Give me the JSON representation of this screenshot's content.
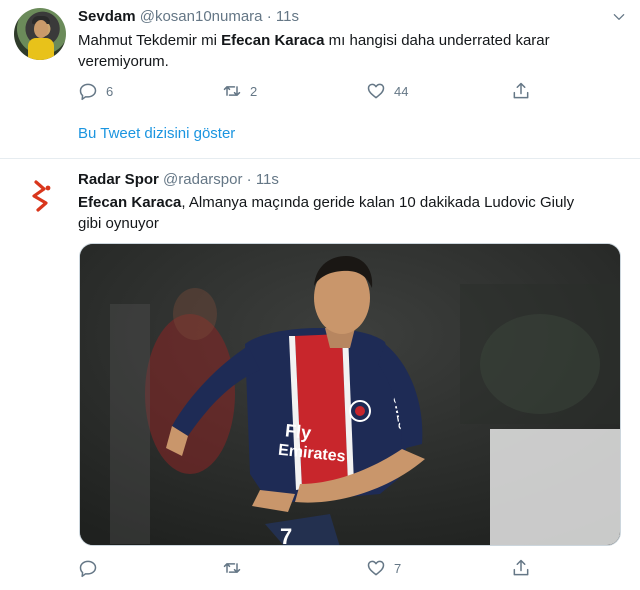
{
  "tweet1": {
    "name": "Sevdam",
    "handle": "@kosan10numara",
    "separator": "·",
    "time": "11s",
    "text_part1": "Mahmut Tekdemir mi ",
    "text_bold": "Efecan Karaca",
    "text_part2": " mı hangisi daha underrated karar veremiyorum.",
    "reply_count": "6",
    "retweet_count": "2",
    "like_count": "44"
  },
  "thread_link": "Bu Tweet dizisini göster",
  "tweet2": {
    "name": "Radar Spor",
    "handle": "@radarspor",
    "separator": "·",
    "time": "11s",
    "text_bold": "Efecan Karaca",
    "text_rest": ", Almanya maçında geride kalan 10 dakikada Ludovic Giuly gibi oynuyor",
    "reply_count": "",
    "retweet_count": "",
    "like_count": "7",
    "photo": {
      "shirt_text_line1": "Fly",
      "shirt_text_line2": "Emirates",
      "shirt_side_text": "POWEO"
    }
  },
  "colors": {
    "accent": "#1b95e0",
    "muted": "#657786",
    "text": "#14171a",
    "radar_logo": "#d9361c"
  },
  "icons": [
    "reply-icon",
    "retweet-icon",
    "like-icon",
    "share-icon",
    "chevron-down-icon",
    "radar-spor-logo"
  ]
}
